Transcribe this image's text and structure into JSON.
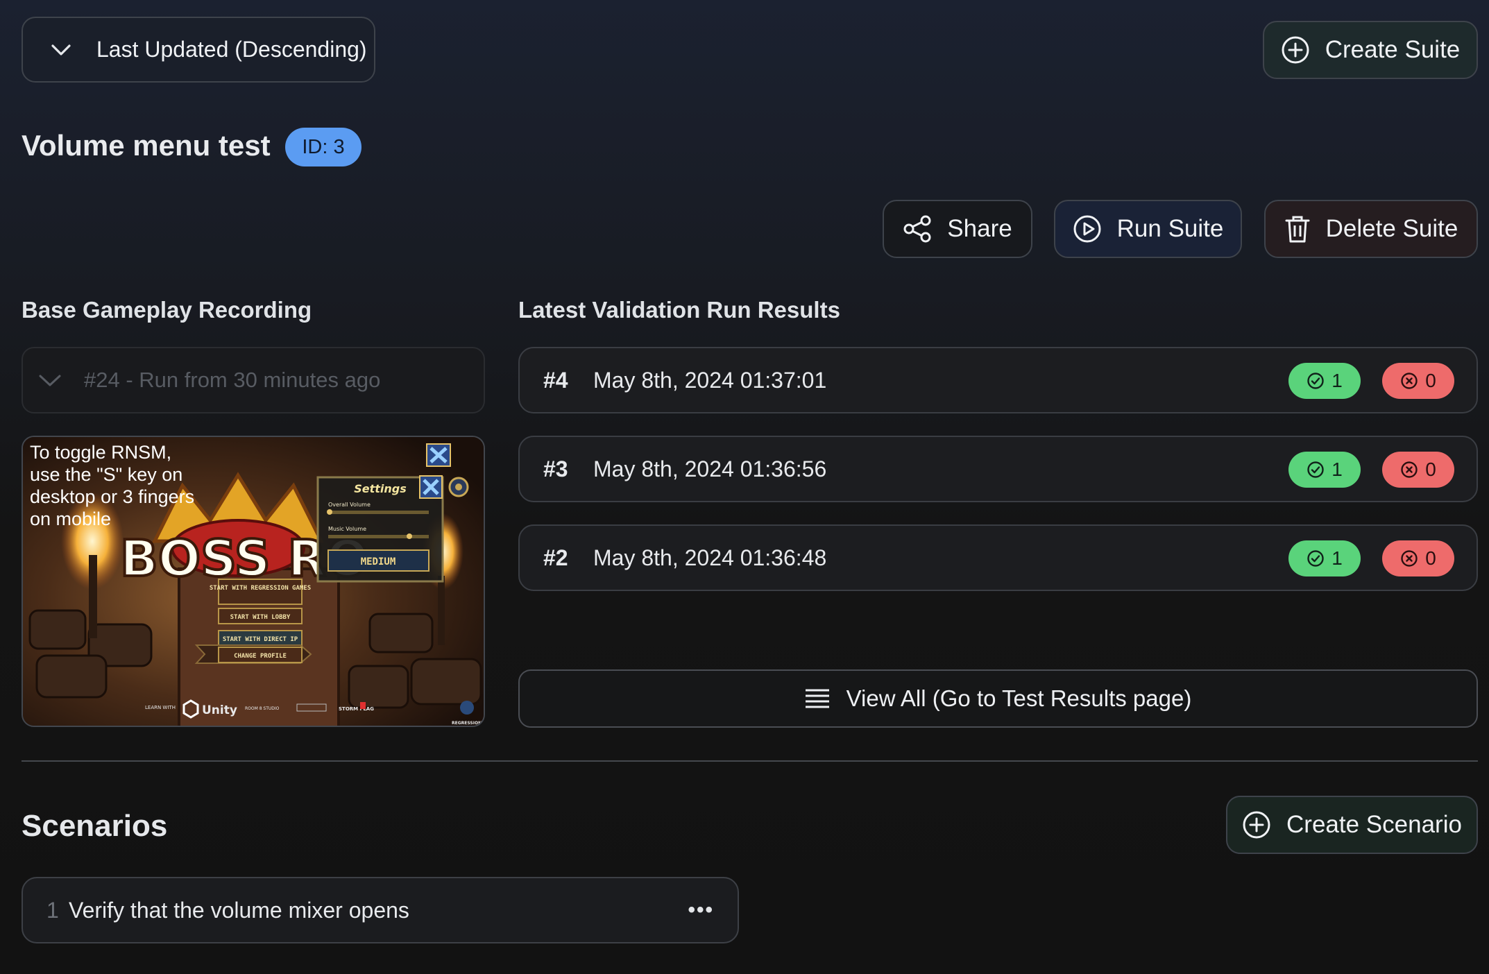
{
  "sort": {
    "label": "Last Updated (Descending)",
    "icon": "chevron-down-icon"
  },
  "create_suite": {
    "label": "Create Suite",
    "icon": "plus-circle-icon"
  },
  "suite": {
    "title": "Volume menu test",
    "id_badge": "ID: 3"
  },
  "actions": {
    "share": "Share",
    "run": "Run Suite",
    "delete": "Delete Suite"
  },
  "recording": {
    "heading": "Base Gameplay Recording",
    "selected": "#24 - Run from 30 minutes ago",
    "overlay_text": "To toggle RNSM, use the \"S\" key on desktop or 3 fingers on mobile",
    "settings_title": "Settings",
    "overall_volume": "Overall Volume",
    "music_volume": "Music Volume",
    "difficulty": "MEDIUM",
    "menu": [
      "START WITH REGRESSION GAMES",
      "START WITH LOBBY",
      "START WITH DIRECT IP",
      "CHANGE PROFILE"
    ],
    "logo_text": "BOSS RO",
    "footer_logos": [
      "LEARN WITH",
      "Unity",
      "ROOM 8 STUDIO",
      "STORM FLAG",
      "REGRESSION"
    ]
  },
  "results": {
    "heading": "Latest Validation Run Results",
    "runs": [
      {
        "num": "#4",
        "date": "May 8th, 2024 01:37:01",
        "passed": "1",
        "failed": "0"
      },
      {
        "num": "#3",
        "date": "May 8th, 2024 01:36:56",
        "passed": "1",
        "failed": "0"
      },
      {
        "num": "#2",
        "date": "May 8th, 2024 01:36:48",
        "passed": "1",
        "failed": "0"
      }
    ],
    "view_all": "View All (Go to Test Results page)"
  },
  "scenarios": {
    "heading": "Scenarios",
    "create_label": "Create Scenario",
    "items": [
      {
        "index": "1",
        "label": "Verify that the volume mixer opens"
      }
    ],
    "more_label": "•••"
  },
  "colors": {
    "pass": "#5ad37b",
    "fail": "#ee6b6b",
    "id_badge": "#5b9cf2"
  }
}
